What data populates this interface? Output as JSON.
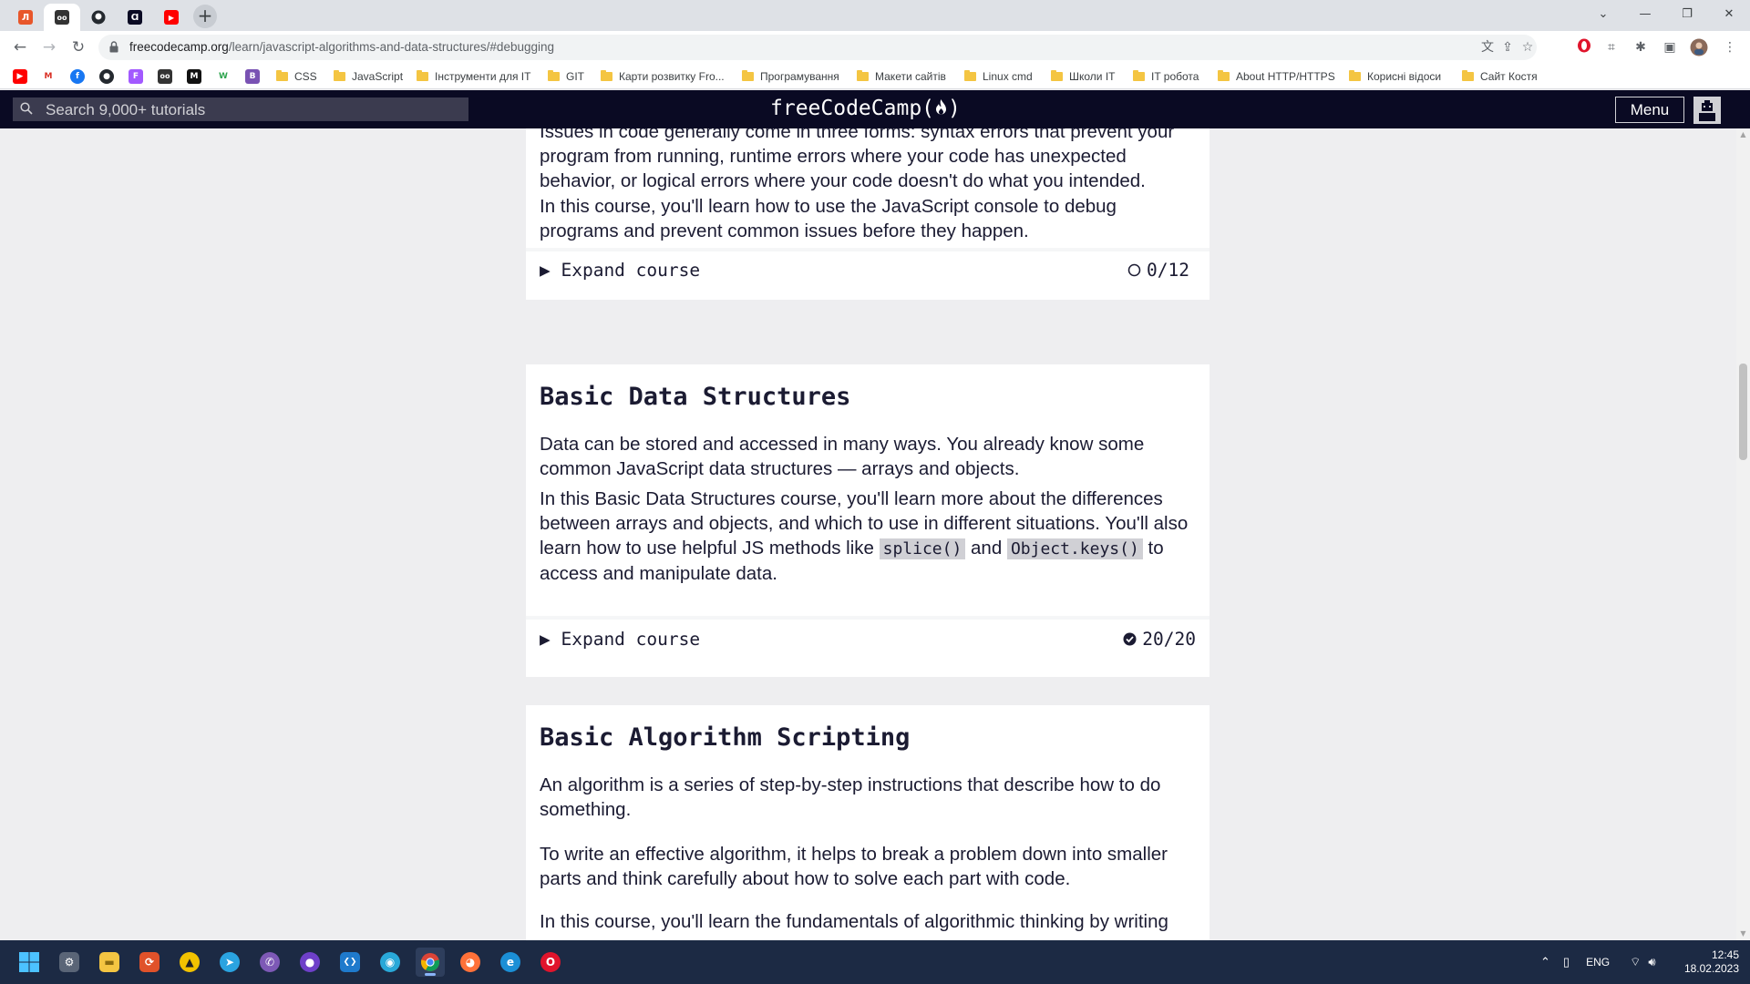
{
  "browser": {
    "tabs": [
      {
        "name": "tab-1",
        "glyph": "Л",
        "color": "#e8562a",
        "active": false
      },
      {
        "name": "tab-2",
        "glyph": "oo",
        "color": "#333333",
        "active": true
      },
      {
        "name": "tab-3",
        "glyph": "",
        "color": "#24292f",
        "active": false
      },
      {
        "name": "tab-4",
        "glyph": "Ɑ",
        "color": "#0a0a23",
        "active": false
      },
      {
        "name": "tab-5",
        "glyph": "▶",
        "color": "#ff0000",
        "active": false
      }
    ],
    "url_host": "freecodecamp.org",
    "url_path": "/learn/javascript-algorithms-and-data-structures/#debugging",
    "bookmarks": [
      {
        "label": "CSS"
      },
      {
        "label": "JavaScript"
      },
      {
        "label": "Інструменти для IT"
      },
      {
        "label": "GIT"
      },
      {
        "label": "Карти розвитку Fro..."
      },
      {
        "label": "Програмування"
      },
      {
        "label": "Макети сайтів"
      },
      {
        "label": "Linux cmd"
      },
      {
        "label": "Школи IT"
      },
      {
        "label": "IT робота"
      },
      {
        "label": "About HTTP/HTTPS"
      },
      {
        "label": "Корисні відоси"
      },
      {
        "label": "Сайт Костя"
      }
    ]
  },
  "fcc": {
    "search_placeholder": "Search 9,000+ tutorials",
    "logo": "freeCodeCamp(🔥)",
    "logo_text": "freeCodeCamp(",
    "logo_close": ")",
    "menu_label": "Menu"
  },
  "blocks": [
    {
      "name": "debugging",
      "paragraphs": [
        "Issues in code generally come in three forms: syntax errors that prevent your program from running, runtime errors where your code has unexpected behavior, or logical errors where your code doesn't do what you intended.",
        "In this course, you'll learn how to use the JavaScript console to debug programs and prevent common issues before they happen."
      ],
      "expand_label": "Expand course",
      "progress": "0/12",
      "completed": false
    },
    {
      "name": "basic-data-structures",
      "title": "Basic Data Structures",
      "p1": "Data can be stored and accessed in many ways. You already know some common JavaScript data structures — arrays and objects.",
      "p2_before": "In this Basic Data Structures course, you'll learn more about the differences between arrays and objects, and which to use in different situations. You'll also learn how to use helpful JS methods like ",
      "p2_code1": "splice()",
      "p2_mid": " and ",
      "p2_code2": "Object.keys()",
      "p2_after": " to access and manipulate data.",
      "expand_label": "Expand course",
      "progress": "20/20",
      "completed": true
    },
    {
      "name": "basic-algorithm-scripting",
      "title": "Basic Algorithm Scripting",
      "paragraphs": [
        "An algorithm is a series of step-by-step instructions that describe how to do something.",
        "To write an effective algorithm, it helps to break a problem down into smaller parts and think carefully about how to solve each part with code.",
        "In this course, you'll learn the fundamentals of algorithmic thinking by writing"
      ]
    }
  ],
  "taskbar": {
    "apps": [
      {
        "name": "start-button",
        "glyph": "⊞",
        "color": "#1c2a44"
      },
      {
        "name": "settings-app",
        "glyph": "⚙",
        "color": "#5a6577"
      },
      {
        "name": "file-explorer-app",
        "glyph": "▬",
        "color": "#f4c542"
      },
      {
        "name": "git-app",
        "glyph": "⟳",
        "color": "#e0522a"
      },
      {
        "name": "norton-app",
        "glyph": "▲",
        "color": "#f2c200"
      },
      {
        "name": "telegram-app",
        "glyph": "➤",
        "color": "#2aa3e0"
      },
      {
        "name": "viber-app",
        "glyph": "✆",
        "color": "#7d59b6"
      },
      {
        "name": "github-desktop-app",
        "glyph": "●",
        "color": "#6e40c9"
      },
      {
        "name": "vscode-app",
        "glyph": "❮❯",
        "color": "#1f7acc"
      },
      {
        "name": "app-blue-circle",
        "glyph": "◉",
        "color": "#29a8d8"
      },
      {
        "name": "chrome-app",
        "glyph": "◎",
        "color": "#dd4b39",
        "active": true
      },
      {
        "name": "firefox-app",
        "glyph": "◕",
        "color": "#ff7139"
      },
      {
        "name": "edge-app",
        "glyph": "e",
        "color": "#1b8fd6"
      },
      {
        "name": "opera-app",
        "glyph": "O",
        "color": "#e0142c"
      }
    ],
    "language": "ENG",
    "time": "12:45",
    "date": "18.02.2023"
  }
}
